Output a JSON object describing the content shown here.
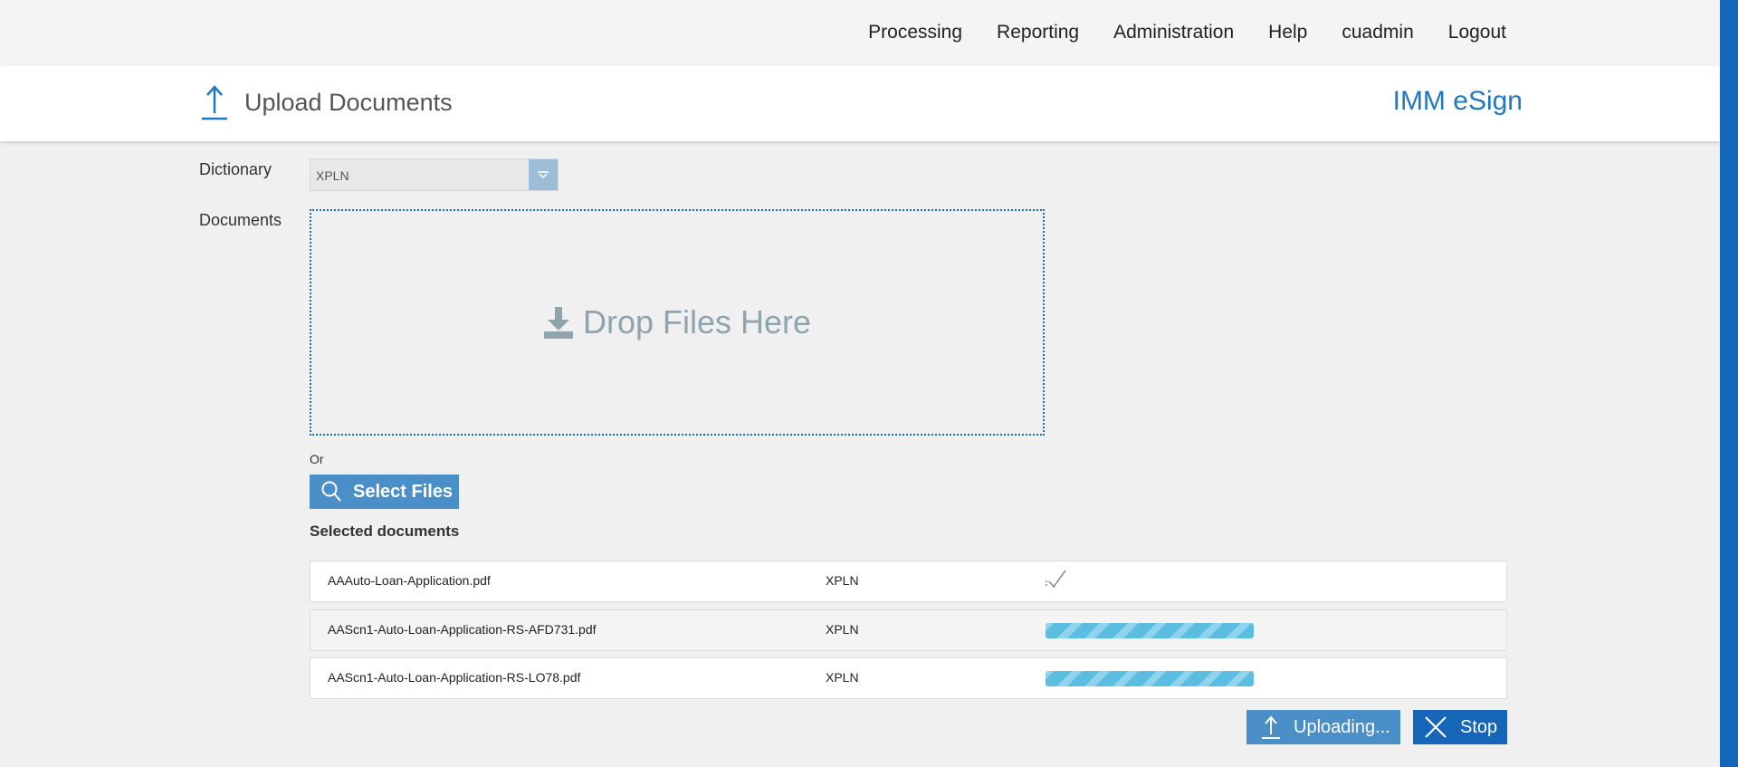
{
  "nav": {
    "items": [
      {
        "label": "Processing"
      },
      {
        "label": "Reporting"
      },
      {
        "label": "Administration"
      },
      {
        "label": "Help"
      },
      {
        "label": "cuadmin"
      },
      {
        "label": "Logout"
      }
    ]
  },
  "header": {
    "title": "Upload Documents",
    "brand": "IMM eSign",
    "icon": "upload-icon"
  },
  "form": {
    "dictionary_label": "Dictionary",
    "dictionary_value": "XPLN",
    "documents_label": "Documents",
    "drop_text": "Drop Files Here",
    "or_text": "Or",
    "select_files_label": "Select Files",
    "selected_documents_title": "Selected documents"
  },
  "documents": [
    {
      "name": "AAAuto-Loan-Application.pdf",
      "dictionary": "XPLN",
      "status": "complete"
    },
    {
      "name": "AAScn1-Auto-Loan-Application-RS-AFD731.pdf",
      "dictionary": "XPLN",
      "status": "uploading"
    },
    {
      "name": "AAScn1-Auto-Loan-Application-RS-LO78.pdf",
      "dictionary": "XPLN",
      "status": "uploading"
    }
  ],
  "actions": {
    "uploading_label": "Uploading...",
    "stop_label": "Stop"
  },
  "colors": {
    "accent": "#1565b8",
    "button": "#4a8fc7",
    "brand": "#1e78c2",
    "progress": "#5bbde0"
  }
}
